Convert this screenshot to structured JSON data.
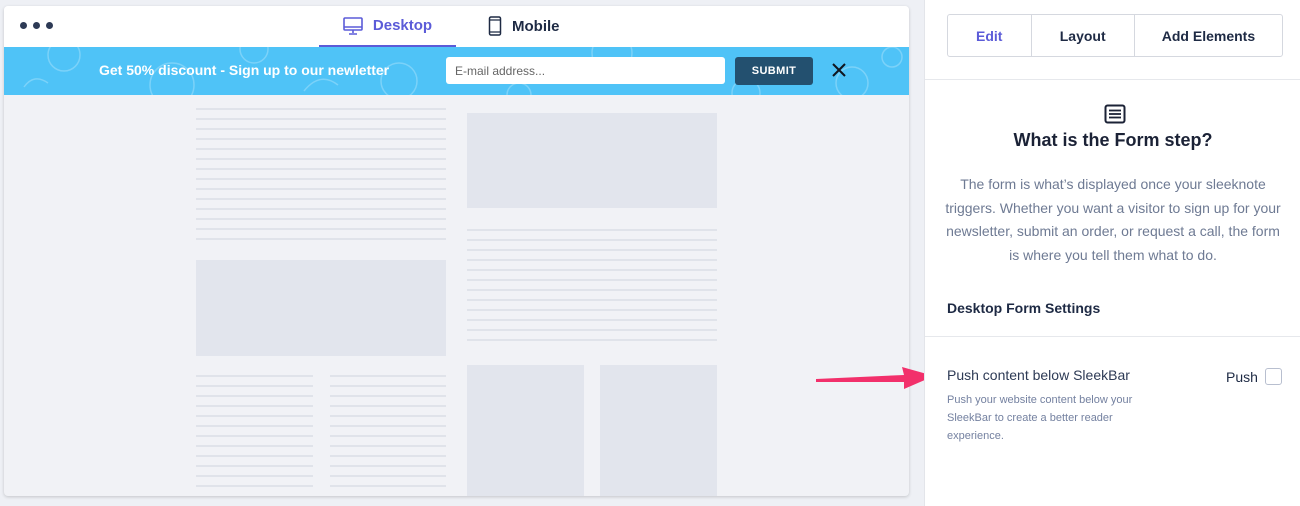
{
  "preview": {
    "tabs": [
      {
        "label": "Desktop",
        "icon": "monitor-icon",
        "active": true
      },
      {
        "label": "Mobile",
        "icon": "mobile-phone-icon",
        "active": false
      }
    ],
    "sleekbar": {
      "text": "Get 50% discount - Sign up to our newletter",
      "email_placeholder": "E-mail address...",
      "submit_label": "SUBMIT",
      "background": "#4fc3f7",
      "button_color": "#23506f"
    }
  },
  "panel": {
    "tabs": [
      {
        "label": "Edit",
        "active": true
      },
      {
        "label": "Layout",
        "active": false
      },
      {
        "label": "Add Elements",
        "active": false
      }
    ],
    "info": {
      "icon": "form-icon",
      "title": "What is the Form step?",
      "text": "The form is what’s displayed once your sleeknote triggers. Whether you want a visitor to sign up for your newsletter, submit an order, or request a call, the form is where you tell them what to do."
    },
    "section_title": "Desktop Form Settings",
    "option": {
      "label": "Push content below SleekBar",
      "description": "Push your website content below your SleekBar to create a better reader experience.",
      "toggle_label": "Push",
      "checked": false
    }
  },
  "colors": {
    "accent": "#5b5bd8",
    "arrow": "#f2306b",
    "text_dark": "#1e2a44",
    "muted": "#6e7a93"
  }
}
